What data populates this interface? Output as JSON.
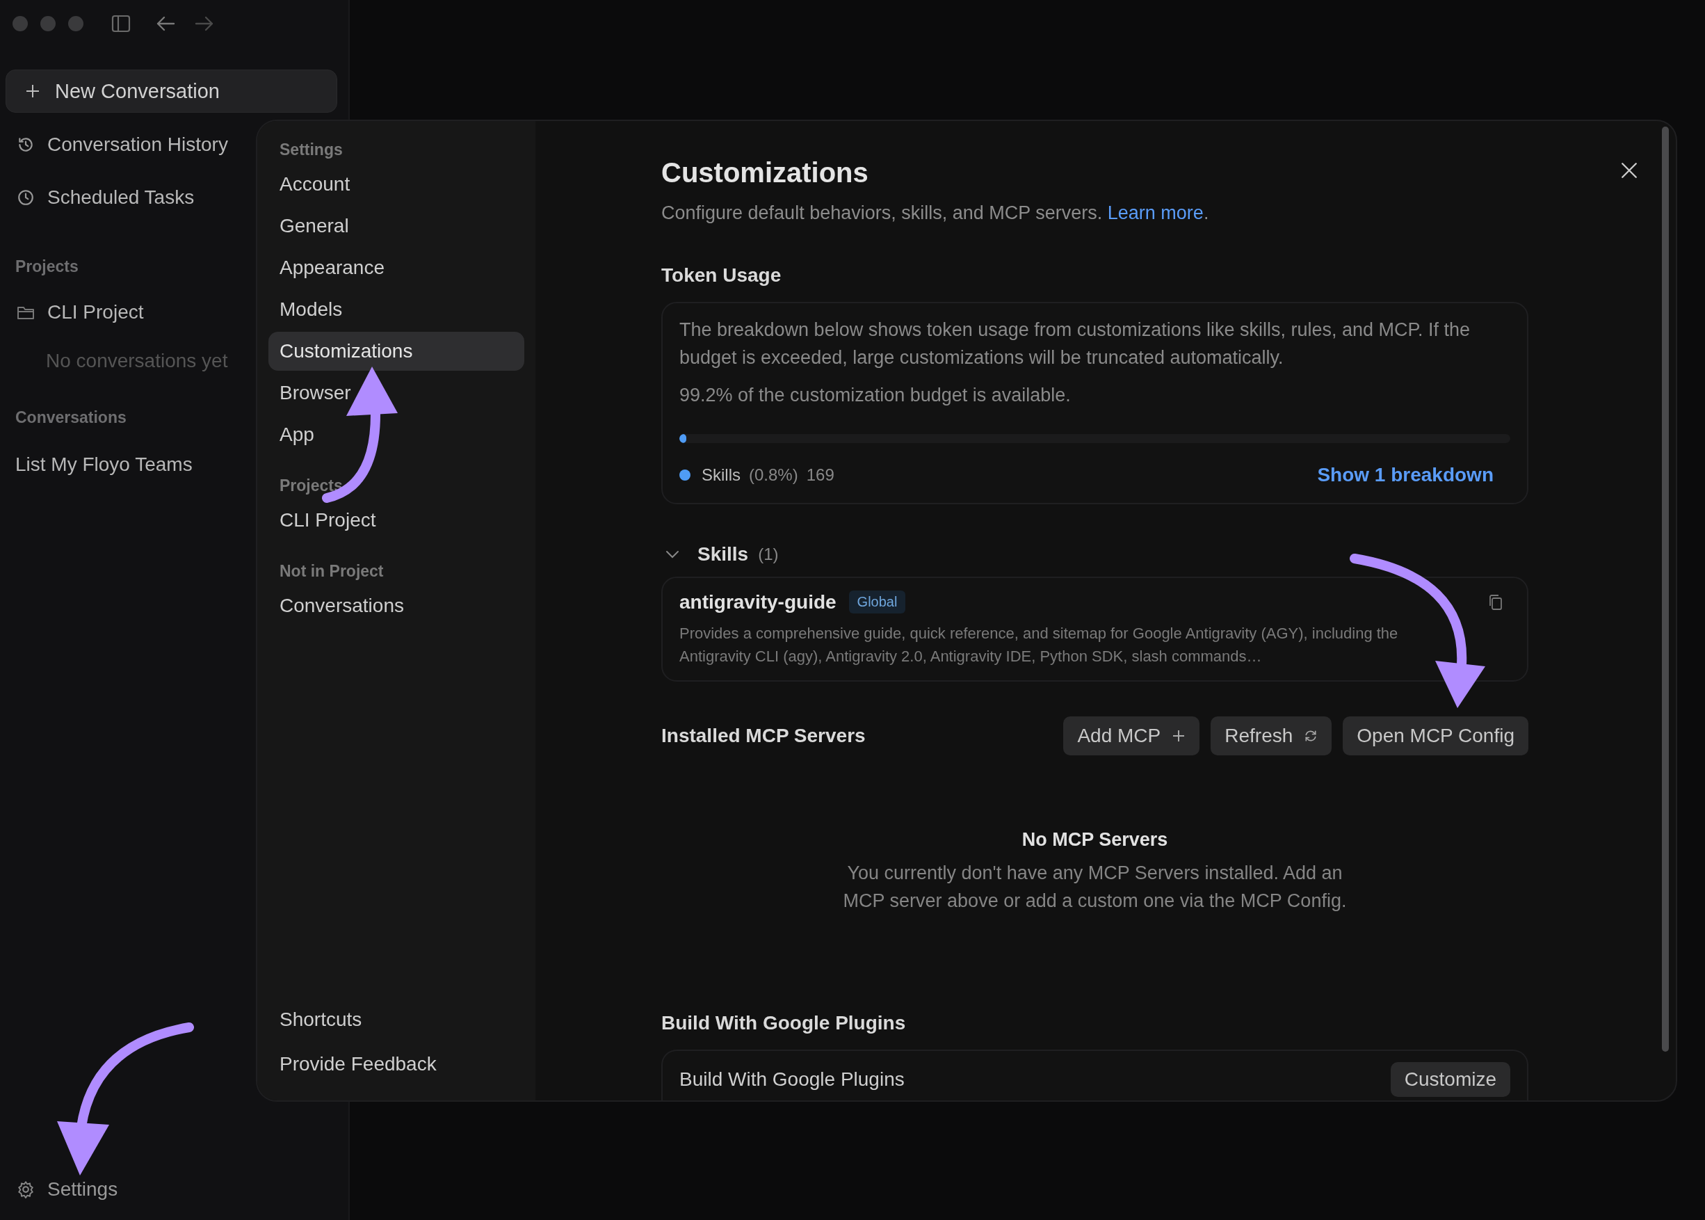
{
  "sidebar": {
    "new_button": "New Conversation",
    "nav": [
      {
        "label": "Conversation History"
      },
      {
        "label": "Scheduled Tasks"
      }
    ],
    "projects_label": "Projects",
    "projects": [
      {
        "name": "CLI Project",
        "empty_text": "No conversations yet"
      }
    ],
    "conversations_label": "Conversations",
    "conversations": [
      "List My Floyo Teams"
    ],
    "settings": "Settings"
  },
  "settings_nav": {
    "sections": [
      {
        "heading": "Settings",
        "items": [
          {
            "label": "Account",
            "selected": false
          },
          {
            "label": "General",
            "selected": false
          },
          {
            "label": "Appearance",
            "selected": false
          },
          {
            "label": "Models",
            "selected": false
          },
          {
            "label": "Customizations",
            "selected": true
          },
          {
            "label": "Browser",
            "selected": false
          },
          {
            "label": "App",
            "selected": false
          }
        ]
      },
      {
        "heading": "Projects",
        "items": [
          {
            "label": "CLI Project",
            "selected": false
          }
        ]
      },
      {
        "heading": "Not in Project",
        "items": [
          {
            "label": "Conversations",
            "selected": false
          }
        ]
      }
    ],
    "footer_items": [
      "Shortcuts",
      "Provide Feedback"
    ]
  },
  "content": {
    "title": "Customizations",
    "description": "Configure default behaviors, skills, and MCP servers.",
    "link": "Learn more",
    "after_link": ".",
    "token_usage": {
      "heading": "Token Usage",
      "explanation": "The breakdown below shows token usage from customizations like skills, rules, and MCP. If the budget is exceeded, large customizations will be truncated automatically.",
      "availability": "99.2% of the customization budget is available.",
      "level": 0.008,
      "legend": [
        {
          "name": "Skills",
          "share": "(0.8%)",
          "count": "169",
          "color": "#4f9cf5"
        }
      ],
      "breakdown_link": "Show 1 breakdown"
    },
    "skills": {
      "heading": "Skills",
      "count": "(1)",
      "expanded": true,
      "items": [
        {
          "name": "antigravity-guide",
          "scope": "Global",
          "description": "Provides a comprehensive guide, quick reference, and sitemap for Google Antigravity (AGY), including the Antigravity CLI (agy), Antigravity 2.0, Antigravity IDE, Python SDK, slash commands…"
        }
      ]
    },
    "mcp": {
      "heading": "Installed MCP Servers",
      "buttons": [
        "Add MCP",
        "Refresh",
        "Open MCP Config"
      ],
      "empty_title": "No MCP Servers",
      "empty_text": "You currently don't have any MCP Servers installed. Add an MCP server above or add a custom one via the MCP Config."
    },
    "plugins": {
      "heading": "Build With Google Plugins",
      "card_title": "Build With Google Plugins",
      "card_button": "Customize"
    }
  }
}
